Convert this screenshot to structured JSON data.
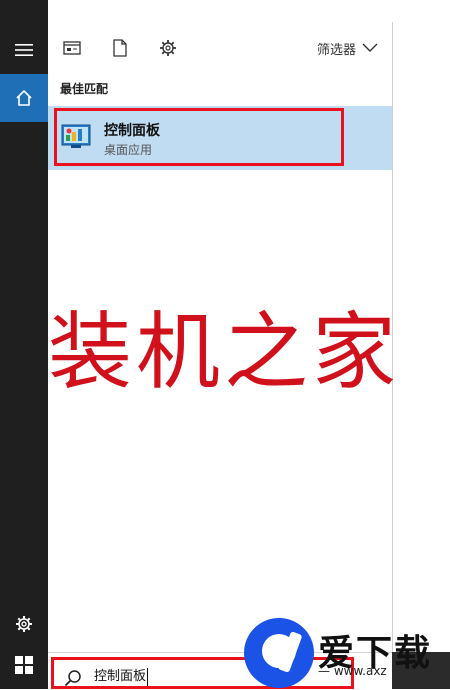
{
  "toolbar": {
    "filter_label": "筛选器"
  },
  "rail": {
    "icons": [
      "hamburger-icon",
      "home-icon",
      "gear-icon",
      "windows-icon"
    ]
  },
  "results": {
    "section_label": "最佳匹配",
    "best_match": {
      "title": "控制面板",
      "subtitle": "桌面应用",
      "icon": "control-panel-icon"
    }
  },
  "watermark": {
    "text": "装机之家"
  },
  "search": {
    "value": "控制面板"
  },
  "logo": {
    "name": "爱下载",
    "url": "— www.axz"
  },
  "colors": {
    "accent": "#1e6fb6",
    "selection": "#c0dcf3",
    "highlight_border": "#e8111c",
    "watermark": "#d0101b",
    "logo_blue": "#1a53e6"
  }
}
